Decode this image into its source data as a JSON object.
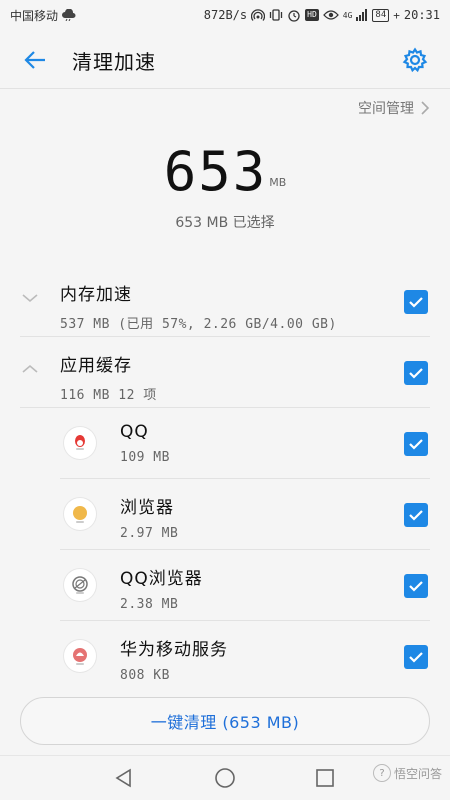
{
  "status_bar": {
    "carrier": "中国移动",
    "net_speed": "872B/s",
    "hd_label": "HD",
    "net_type": "4G",
    "battery": "84",
    "time": "20:31"
  },
  "header": {
    "title": "清理加速"
  },
  "space_manage": {
    "label": "空间管理"
  },
  "summary": {
    "size_value": "653",
    "size_unit": "MB",
    "selected_text": "653 MB 已选择"
  },
  "items": [
    {
      "name": "内存加速",
      "sub": "537 MB (已用 57%, 2.26 GB/4.00 GB)"
    },
    {
      "name": "应用缓存",
      "sub": "116 MB 12 项"
    }
  ],
  "apps": [
    {
      "name": "QQ",
      "size": "109 MB",
      "icon": "qq-icon"
    },
    {
      "name": "浏览器",
      "size": "2.97 MB",
      "icon": "browser-icon"
    },
    {
      "name": "QQ浏览器",
      "size": "2.38 MB",
      "icon": "qq-browser-icon"
    },
    {
      "name": "华为移动服务",
      "size": "808 KB",
      "icon": "huawei-mobile-services-icon"
    }
  ],
  "clean_button": {
    "label": "一键清理 (653 MB)"
  },
  "watermark": {
    "text": "悟空问答"
  },
  "colors": {
    "accent": "#1e88e5",
    "button_text": "#1e6fd9"
  }
}
